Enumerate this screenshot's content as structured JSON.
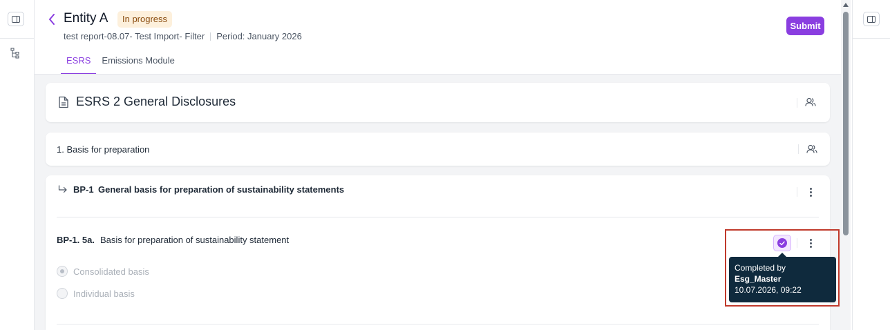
{
  "header": {
    "title": "Entity A",
    "status": "In progress",
    "report_name": "test report-08.07- Test Import- Filter",
    "period": "Period: January 2026",
    "submit_label": "Submit"
  },
  "tabs": [
    {
      "label": "ESRS",
      "active": true
    },
    {
      "label": "Emissions Module",
      "active": false
    }
  ],
  "section": {
    "title": "ESRS 2 General Disclosures"
  },
  "subsection": {
    "title": "1. Basis for preparation"
  },
  "requirement": {
    "code": "BP-1",
    "title": "General basis for preparation of sustainability statements"
  },
  "question": {
    "code": "BP-1. 5a.",
    "title": "Basis for preparation of sustainability statement",
    "options": [
      {
        "label": "Consolidated basis",
        "selected": true
      },
      {
        "label": "Individual basis",
        "selected": false
      }
    ]
  },
  "tooltip": {
    "line1": "Completed by",
    "user": "Esg_Master",
    "timestamp": "10.07.2026, 09:22"
  },
  "colors": {
    "accent": "#8a3ee0",
    "status_bg": "#fdf0dc",
    "status_text": "#8a4b0e",
    "tooltip_bg": "#0f2a3d",
    "highlight": "#c0392b"
  },
  "icons": [
    "panel-toggle-icon",
    "tree-icon",
    "back-chevron-icon",
    "document-icon",
    "users-icon",
    "arrow-return-icon",
    "kebab-icon",
    "check-circle-icon"
  ]
}
